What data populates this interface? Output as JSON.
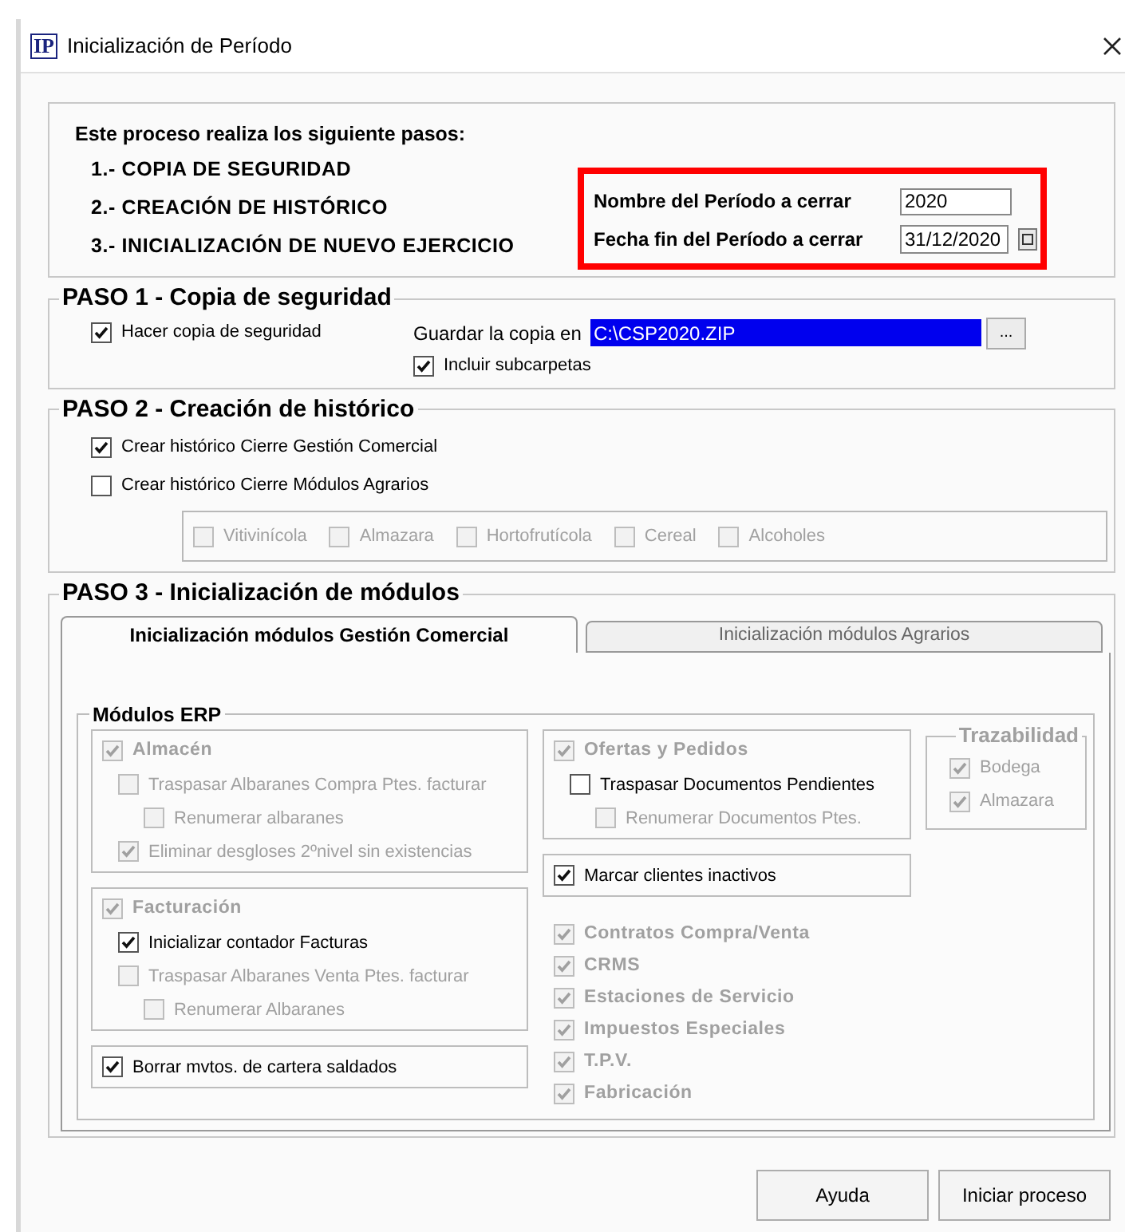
{
  "window": {
    "logo_text": "IP",
    "title": "Inicialización de Período"
  },
  "intro": {
    "heading": "Este proceso realiza los siguiente pasos:",
    "steps": [
      "1.- COPIA DE SEGURIDAD",
      "2.- CREACIÓN DE HISTÓRICO",
      "3.- INICIALIZACIÓN DE NUEVO EJERCICIO"
    ]
  },
  "period": {
    "name_label": "Nombre del Período a cerrar",
    "name_value": "2020",
    "end_label": "Fecha fin del Período a cerrar",
    "end_value": "31/12/2020"
  },
  "step1": {
    "legend": "PASO 1 - Copia de seguridad",
    "backup": {
      "label": "Hacer copia de seguridad",
      "checked": true,
      "disabled": false
    },
    "save_label": "Guardar la copia en",
    "save_path": "C:\\CSP2020.ZIP",
    "browse": "...",
    "subfolders": {
      "label": "Incluir subcarpetas",
      "checked": true,
      "disabled": false
    }
  },
  "step2": {
    "legend": "PASO 2 - Creación de histórico",
    "options": [
      {
        "label": "Crear histórico Cierre Gestión Comercial",
        "checked": true,
        "disabled": false
      },
      {
        "label": "Crear histórico Cierre Módulos Agrarios",
        "checked": false,
        "disabled": false
      }
    ],
    "agrarian": [
      {
        "label": "Vitivinícola",
        "checked": false,
        "disabled": true
      },
      {
        "label": "Almazara",
        "checked": false,
        "disabled": true
      },
      {
        "label": "Hortofrutícola",
        "checked": false,
        "disabled": true
      },
      {
        "label": "Cereal",
        "checked": false,
        "disabled": true
      },
      {
        "label": "Alcoholes",
        "checked": false,
        "disabled": true
      }
    ]
  },
  "step3": {
    "legend": "PASO 3 - Inicialización de módulos",
    "tabs": [
      {
        "label": "Inicialización módulos Gestión Comercial",
        "selected": true
      },
      {
        "label": "Inicialización módulos Agrarios",
        "selected": false
      }
    ],
    "erp": {
      "legend": "Módulos ERP",
      "columns": [
        [
          {
            "boxed": true,
            "items": [
              {
                "kind": "module",
                "label": "Almacén",
                "checked": true,
                "disabled": true,
                "children": [
                  {
                    "kind": "option",
                    "label": "Traspasar Albaranes Compra Ptes. facturar",
                    "checked": false,
                    "disabled": true,
                    "children": [
                      {
                        "kind": "option",
                        "label": "Renumerar albaranes",
                        "checked": false,
                        "disabled": true
                      }
                    ]
                  },
                  {
                    "kind": "option",
                    "label": "Eliminar desgloses 2ºnivel sin existencias",
                    "checked": true,
                    "disabled": true
                  }
                ]
              }
            ]
          },
          {
            "boxed": true,
            "items": [
              {
                "kind": "module",
                "label": "Facturación",
                "checked": true,
                "disabled": true,
                "children": [
                  {
                    "kind": "option",
                    "label": "Inicializar contador Facturas",
                    "checked": true,
                    "disabled": false
                  },
                  {
                    "kind": "option",
                    "label": "Traspasar Albaranes Venta Ptes. facturar",
                    "checked": false,
                    "disabled": true,
                    "children": [
                      {
                        "kind": "option",
                        "label": "Renumerar Albaranes",
                        "checked": false,
                        "disabled": true
                      }
                    ]
                  }
                ]
              }
            ]
          },
          {
            "boxed": true,
            "items": [
              {
                "kind": "option",
                "label": "Borrar mvtos. de cartera saldados",
                "checked": true,
                "disabled": false
              }
            ]
          }
        ],
        [
          {
            "boxed": true,
            "items": [
              {
                "kind": "module",
                "label": "Ofertas y Pedidos",
                "checked": true,
                "disabled": true,
                "children": [
                  {
                    "kind": "option",
                    "label": "Traspasar Documentos Pendientes",
                    "checked": false,
                    "disabled": false,
                    "children": [
                      {
                        "kind": "option",
                        "label": "Renumerar Documentos Ptes.",
                        "checked": false,
                        "disabled": true
                      }
                    ]
                  }
                ]
              }
            ]
          },
          {
            "boxed": true,
            "items": [
              {
                "kind": "option",
                "label": "Marcar clientes inactivos",
                "checked": true,
                "disabled": false
              }
            ]
          },
          {
            "boxed": false,
            "items": [
              {
                "kind": "module",
                "label": "Contratos Compra/Venta",
                "checked": true,
                "disabled": true
              },
              {
                "kind": "module",
                "label": "CRMS",
                "checked": true,
                "disabled": true
              },
              {
                "kind": "module",
                "label": "Estaciones de Servicio",
                "checked": true,
                "disabled": true
              },
              {
                "kind": "module",
                "label": "Impuestos Especiales",
                "checked": true,
                "disabled": true
              },
              {
                "kind": "module",
                "label": "T.P.V.",
                "checked": true,
                "disabled": true
              },
              {
                "kind": "module",
                "label": "Fabricación",
                "checked": true,
                "disabled": true
              }
            ]
          }
        ]
      ],
      "traceability": {
        "legend": "Trazabilidad",
        "items": [
          {
            "kind": "option",
            "label": "Bodega",
            "checked": true,
            "disabled": true
          },
          {
            "kind": "option",
            "label": "Almazara",
            "checked": true,
            "disabled": true
          }
        ]
      }
    }
  },
  "buttons": [
    {
      "label": "Ayuda"
    },
    {
      "label": "Iniciar proceso"
    }
  ]
}
